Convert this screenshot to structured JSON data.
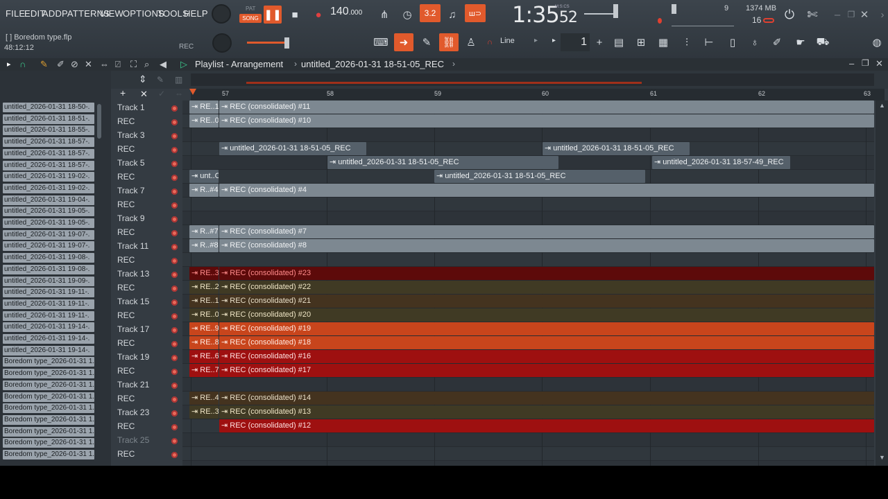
{
  "menu": [
    "FILE",
    "EDIT",
    "ADD",
    "PATTERNS",
    "VIEW",
    "OPTIONS",
    "TOOLS",
    "HELP"
  ],
  "transport": {
    "pat": "PAT",
    "song": "SONG",
    "tempo": "140",
    "tempo_dec": ".000",
    "time_main": "1:35",
    "time_sec": "52",
    "time_label": "M:S:CS",
    "cpu": "9",
    "ram": "1374 MB",
    "voices": "16",
    "rec": "REC"
  },
  "hint": {
    "file": "[ ] Boredom type.flp",
    "pos": "48:12:12"
  },
  "toolbar": {
    "snap": "Line",
    "step": "1"
  },
  "playlist": {
    "title": "Playlist - Arrangement",
    "pattern": "untitled_2026-01-31 18-51-05_REC"
  },
  "ruler": [
    "57",
    "58",
    "59",
    "60",
    "61",
    "62",
    "63"
  ],
  "browser": [
    "untitled_2026-01-31 18-50-.",
    "untitled_2026-01-31 18-51-.",
    "untitled_2026-01-31 18-55-.",
    "untitled_2026-01-31 18-57-.",
    "untitled_2026-01-31 18-57-.",
    "untitled_2026-01-31 18-57-.",
    "untitled_2026-01-31 19-02-.",
    "untitled_2026-01-31 19-02-.",
    "untitled_2026-01-31 19-04-.",
    "untitled_2026-01-31 19-05-.",
    "untitled_2026-01-31 19-05-.",
    "untitled_2026-01-31 19-07-.",
    "untitled_2026-01-31 19-07-.",
    "untitled_2026-01-31 19-08-.",
    "untitled_2026-01-31 19-08-.",
    "untitled_2026-01-31 19-09-.",
    "untitled_2026-01-31 19-11-.",
    "untitled_2026-01-31 19-11-.",
    "untitled_2026-01-31 19-11-.",
    "untitled_2026-01-31 19-14-.",
    "untitled_2026-01-31 19-14-.",
    "untitled_2026-01-31 19-14-.",
    "Boredom type_2026-01-31 1.",
    "Boredom type_2026-01-31 1.",
    "Boredom type_2026-01-31 1.",
    "Boredom type_2026-01-31 1.",
    "Boredom type_2026-01-31 1.",
    "Boredom type_2026-01-31 1.",
    "Boredom type_2026-01-31 1.",
    "Boredom type_2026-01-31 1.",
    "Boredom type_2026-01-31 1."
  ],
  "tracks": [
    {
      "name": "Track 1"
    },
    {
      "name": "REC"
    },
    {
      "name": "Track 3"
    },
    {
      "name": "REC"
    },
    {
      "name": "Track 5"
    },
    {
      "name": "REC"
    },
    {
      "name": "Track 7"
    },
    {
      "name": "REC"
    },
    {
      "name": "Track 9"
    },
    {
      "name": "REC"
    },
    {
      "name": "Track 11"
    },
    {
      "name": "REC"
    },
    {
      "name": "Track 13"
    },
    {
      "name": "REC"
    },
    {
      "name": "Track 15"
    },
    {
      "name": "REC"
    },
    {
      "name": "Track 17"
    },
    {
      "name": "REC"
    },
    {
      "name": "Track 19"
    },
    {
      "name": "REC"
    },
    {
      "name": "Track 21"
    },
    {
      "name": "REC"
    },
    {
      "name": "Track 23"
    },
    {
      "name": "REC"
    },
    {
      "name": "Track 25"
    },
    {
      "name": "REC"
    }
  ],
  "clips": [
    {
      "row": 0,
      "a": "RE..1",
      "b": "REC (consolidated) #11",
      "color": "gray"
    },
    {
      "row": 1,
      "a": "RE..0",
      "b": "REC (consolidated) #10",
      "color": "gray"
    },
    {
      "row": 3,
      "b": "untitled_2026-01-31 18-51-05_REC",
      "color": "slate",
      "seg": 1
    },
    {
      "row": 3,
      "b": "untitled_2026-01-31 18-51-05_REC",
      "color": "slate",
      "seg": 2
    },
    {
      "row": 4,
      "b": "untitled_2026-01-31 18-51-05_REC",
      "color": "slate",
      "seg": 3
    },
    {
      "row": 4,
      "b": "untitled_2026-01-31 18-57-49_REC",
      "color": "slate",
      "seg": 4
    },
    {
      "row": 5,
      "a": "unt..C",
      "b": "untitled_2026-01-31 18-51-05_REC",
      "color": "slate",
      "seg": 5
    },
    {
      "row": 6,
      "a": "R..#4",
      "b": "REC (consolidated) #4",
      "color": "gray"
    },
    {
      "row": 9,
      "a": "R..#7",
      "b": "REC (consolidated) #7",
      "color": "gray"
    },
    {
      "row": 10,
      "a": "R..#8",
      "b": "REC (consolidated) #8",
      "color": "gray"
    },
    {
      "row": 12,
      "a": "RE..3",
      "b": "REC (consolidated) #23",
      "color": "redd"
    },
    {
      "row": 13,
      "a": "RE..2",
      "b": "REC (consolidated) #22",
      "color": "olive"
    },
    {
      "row": 14,
      "a": "RE..1",
      "b": "REC (consolidated) #21",
      "color": "dark"
    },
    {
      "row": 15,
      "a": "RE..0",
      "b": "REC (consolidated) #20",
      "color": "olive"
    },
    {
      "row": 16,
      "a": "RE..9",
      "b": "REC (consolidated) #19",
      "color": "orange"
    },
    {
      "row": 17,
      "a": "RE..8",
      "b": "REC (consolidated) #18",
      "color": "orange"
    },
    {
      "row": 18,
      "a": "RE..6",
      "b": "REC (consolidated) #16",
      "color": "red"
    },
    {
      "row": 19,
      "a": "RE..7",
      "b": "REC (consolidated) #17",
      "color": "red"
    },
    {
      "row": 21,
      "a": "RE..4",
      "b": "REC (consolidated) #14",
      "color": "dark"
    },
    {
      "row": 22,
      "a": "RE..3",
      "b": "REC (consolidated) #13",
      "color": "olive"
    },
    {
      "row": 23,
      "b": "REC (consolidated) #12",
      "color": "red",
      "seg": 6
    }
  ]
}
